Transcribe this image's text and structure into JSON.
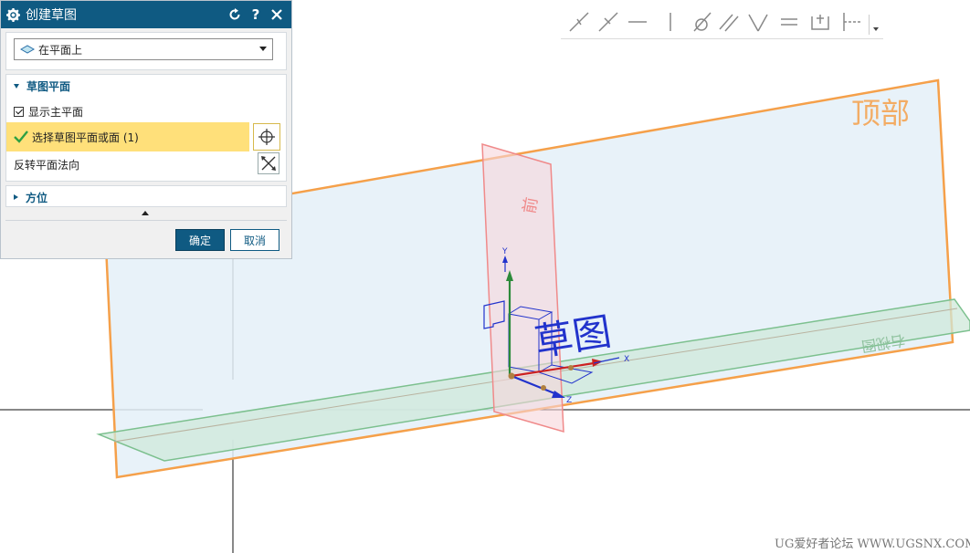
{
  "dialog": {
    "title": "创建草图",
    "plane_type": "在平面上",
    "section_sketch_plane": "草图平面",
    "show_main_plane": "显示主平面",
    "select_plane": "选择草图平面或面 (1)",
    "reverse_normal": "反转平面法向",
    "section_orientation": "方位",
    "ok": "确定",
    "cancel": "取消"
  },
  "viewport": {
    "plane_top_label": "顶部",
    "plane_front_label": "前",
    "plane_side_label": "右视图",
    "sketch_label": "草图",
    "axis_x": "X",
    "axis_y": "Y",
    "axis_z": "Z"
  },
  "watermark": "UG爱好者论坛 WWW.UGSNX.COM",
  "colors": {
    "title_bar": "#0f5a82",
    "highlight": "#ffe07a",
    "top_plane_border": "#f5a04a",
    "top_plane_fill": "#e4f0f8",
    "green_plane": "#7cc08e",
    "pink_plane": "#f08a8a",
    "sketch_blue": "#2233cc"
  },
  "icons": {
    "settings": "gear-icon",
    "reset": "reset-icon",
    "help": "help-icon",
    "close": "close-icon"
  }
}
